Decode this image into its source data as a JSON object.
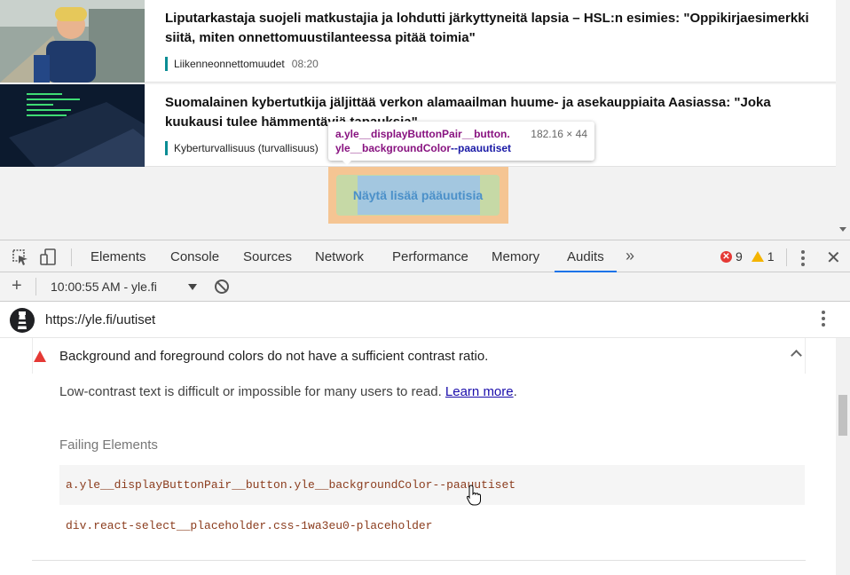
{
  "page": {
    "articles": [
      {
        "headline": "Liputarkastaja suojeli matkustajia ja lohdutti järkyttyneitä lapsia – HSL:n esimies: \"Oppikirjaesimerkki siitä, miten onnettomuustilanteessa pitää toimia\"",
        "category": "Liikenneonnettomuudet",
        "time": "08:20"
      },
      {
        "headline": "Suomalainen kybertutkija jäljittää verkon alamaailman huume- ja asekauppiaita Aasiassa: \"Joka kuukausi tulee hämmentäviä tapauksia\"",
        "category": "Kyberturvallisuus (turvallisuus)",
        "time": ""
      }
    ],
    "more_button_label": "Näytä lisää pääuutisia",
    "tooltip": {
      "selector_line1": "a.yle__displayButtonPair__button.",
      "selector_line2_tag": "yle__backgroundColor",
      "selector_line2_rest": "--paauutiset",
      "dimensions": "182.16 × 44"
    }
  },
  "devtools": {
    "tabs": [
      "Elements",
      "Console",
      "Sources",
      "Network",
      "Performance",
      "Memory",
      "Audits"
    ],
    "active_tab": "Audits",
    "more_tabs": "»",
    "errors_count": "9",
    "warnings_count": "1",
    "close_label": "✕",
    "audits_toolbar": {
      "add_label": "+",
      "run_label": "10:00:55 AM - yle.fi"
    },
    "url": "https://yle.fi/uutiset",
    "audit": {
      "title": "Background and foreground colors do not have a sufficient contrast ratio.",
      "description": "Low-contrast text is difficult or impossible for many users to read.",
      "learn_more": "Learn more",
      "learn_more_suffix": ".",
      "failing_label": "Failing Elements",
      "failing_nodes": [
        "a.yle__displayButtonPair__button.yle__backgroundColor--paauutiset",
        "div.react-select__placeholder.css-1wa3eu0-placeholder"
      ]
    }
  },
  "colors": {
    "accent_teal": "#0a8d94",
    "tab_underline": "#1a73e8",
    "fail_red": "#e53935",
    "warn_yellow": "#f4b400"
  }
}
